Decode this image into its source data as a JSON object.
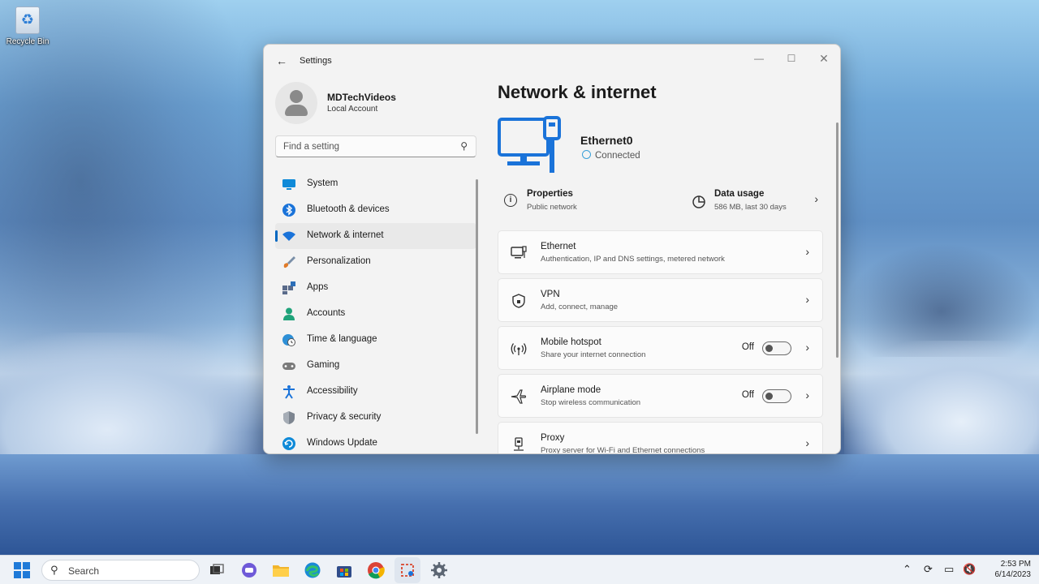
{
  "desktop": {
    "icons": [
      {
        "label": "Recycle Bin",
        "icon": "recycle-bin-icon"
      }
    ]
  },
  "window": {
    "title": "Settings",
    "controls": {
      "minimize": "—",
      "maximize": "☐",
      "close": "✕"
    },
    "back_icon": "←"
  },
  "sidebar": {
    "profile": {
      "name": "MDTechVideos",
      "account": "Local Account"
    },
    "search_placeholder": "Find a setting",
    "items": [
      {
        "label": "System",
        "icon": "system-icon",
        "color": "#0f8ad8",
        "active": false
      },
      {
        "label": "Bluetooth & devices",
        "icon": "bluetooth-icon",
        "color": "#1a73d9",
        "active": false
      },
      {
        "label": "Network & internet",
        "icon": "wifi-icon",
        "color": "#1a73d9",
        "active": true
      },
      {
        "label": "Personalization",
        "icon": "paintbrush-icon",
        "color": "#e07b2a",
        "active": false
      },
      {
        "label": "Apps",
        "icon": "apps-icon",
        "color": "#5a6b8a",
        "active": false
      },
      {
        "label": "Accounts",
        "icon": "accounts-icon",
        "color": "#1fa37a",
        "active": false
      },
      {
        "label": "Time & language",
        "icon": "globe-clock-icon",
        "color": "#2d8fd6",
        "active": false
      },
      {
        "label": "Gaming",
        "icon": "gamepad-icon",
        "color": "#7a7a7a",
        "active": false
      },
      {
        "label": "Accessibility",
        "icon": "accessibility-icon",
        "color": "#1a73d9",
        "active": false
      },
      {
        "label": "Privacy & security",
        "icon": "shield-icon",
        "color": "#7d8590",
        "active": false
      },
      {
        "label": "Windows Update",
        "icon": "update-icon",
        "color": "#0f8ad8",
        "active": false
      }
    ]
  },
  "main": {
    "title": "Network & internet",
    "connection": {
      "name": "Ethernet0",
      "status": "Connected"
    },
    "summary": [
      {
        "title": "Properties",
        "sub": "Public network",
        "icon": "info-icon"
      },
      {
        "title": "Data usage",
        "sub": "586 MB, last 30 days",
        "icon": "data-usage-icon"
      }
    ],
    "cards": [
      {
        "title": "Ethernet",
        "sub": "Authentication, IP and DNS settings, metered network",
        "icon": "ethernet-icon",
        "toggle": null
      },
      {
        "title": "VPN",
        "sub": "Add, connect, manage",
        "icon": "vpn-shield-icon",
        "toggle": null
      },
      {
        "title": "Mobile hotspot",
        "sub": "Share your internet connection",
        "icon": "hotspot-icon",
        "toggle": "Off"
      },
      {
        "title": "Airplane mode",
        "sub": "Stop wireless communication",
        "icon": "airplane-icon",
        "toggle": "Off"
      },
      {
        "title": "Proxy",
        "sub": "Proxy server for Wi-Fi and Ethernet connections",
        "icon": "proxy-icon",
        "toggle": null
      }
    ]
  },
  "taskbar": {
    "search_placeholder": "Search",
    "apps": [
      "task-view-icon",
      "chat-icon",
      "file-explorer-icon",
      "edge-icon",
      "store-icon",
      "chrome-icon",
      "snipping-tool-icon",
      "settings-icon"
    ],
    "clock": {
      "time": "2:53 PM",
      "date": "6/14/2023"
    }
  }
}
